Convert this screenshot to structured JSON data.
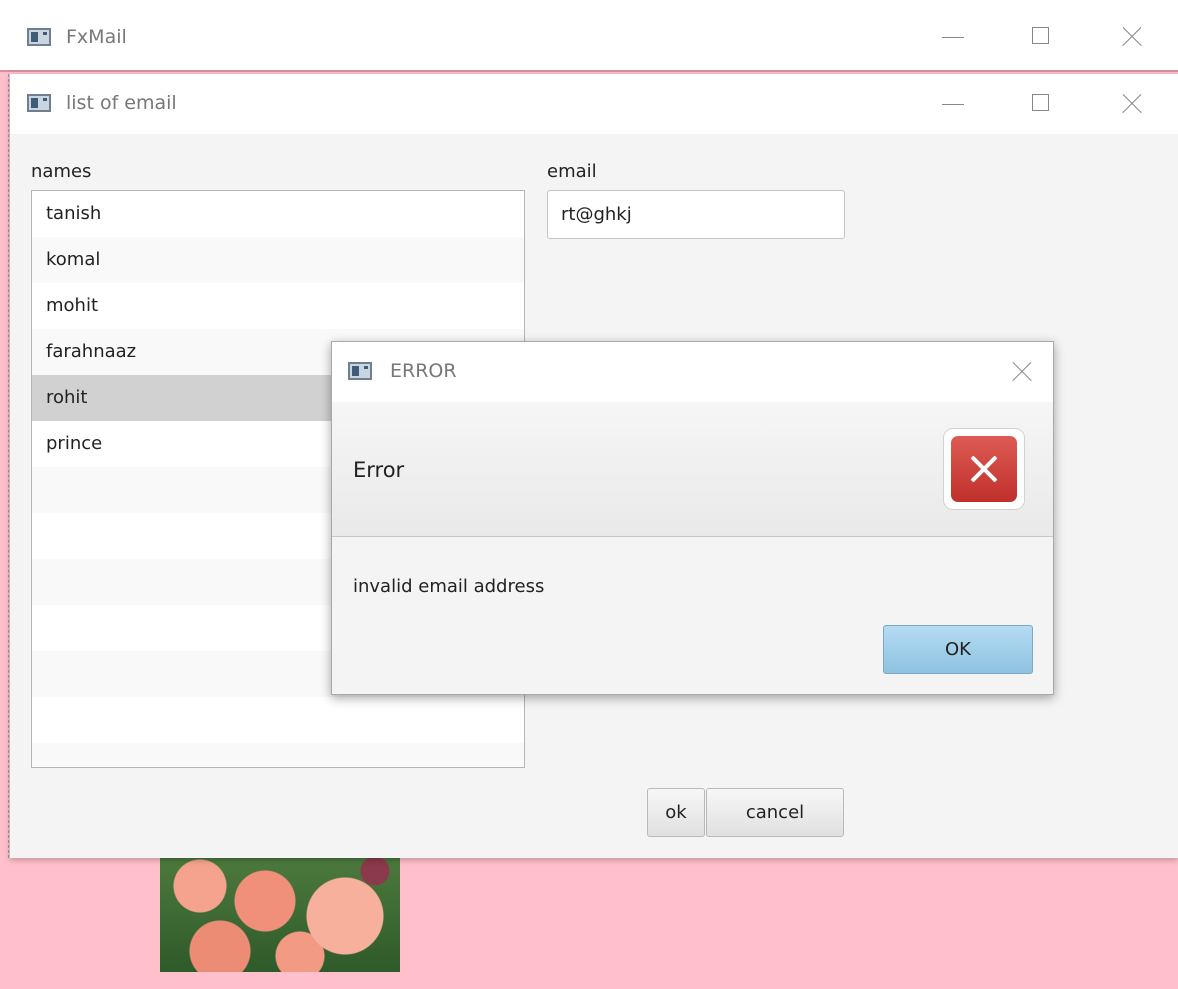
{
  "main_window": {
    "title": "FxMail",
    "icons": {
      "app": "app-window-icon",
      "minimize": "minimize-icon",
      "maximize": "maximize-icon",
      "close": "close-icon"
    }
  },
  "email_window": {
    "title": "list of email",
    "names_label": "names",
    "email_label": "email",
    "email_value": "rt@ghkj",
    "names": [
      "tanish",
      "komal",
      "mohit",
      "farahnaaz",
      "rohit",
      "prince"
    ],
    "selected_name": "rohit",
    "ok_label": "ok",
    "cancel_label": "cancel"
  },
  "error_dialog": {
    "title": "ERROR",
    "header": "Error",
    "message": "invalid email address",
    "ok_label": "OK",
    "icon": "error-x-icon"
  },
  "colors": {
    "main_background": "#ffc0cb",
    "selection": "#d1d1d1",
    "error_icon": "#d04a44",
    "ok_button": "#9fcde8"
  }
}
